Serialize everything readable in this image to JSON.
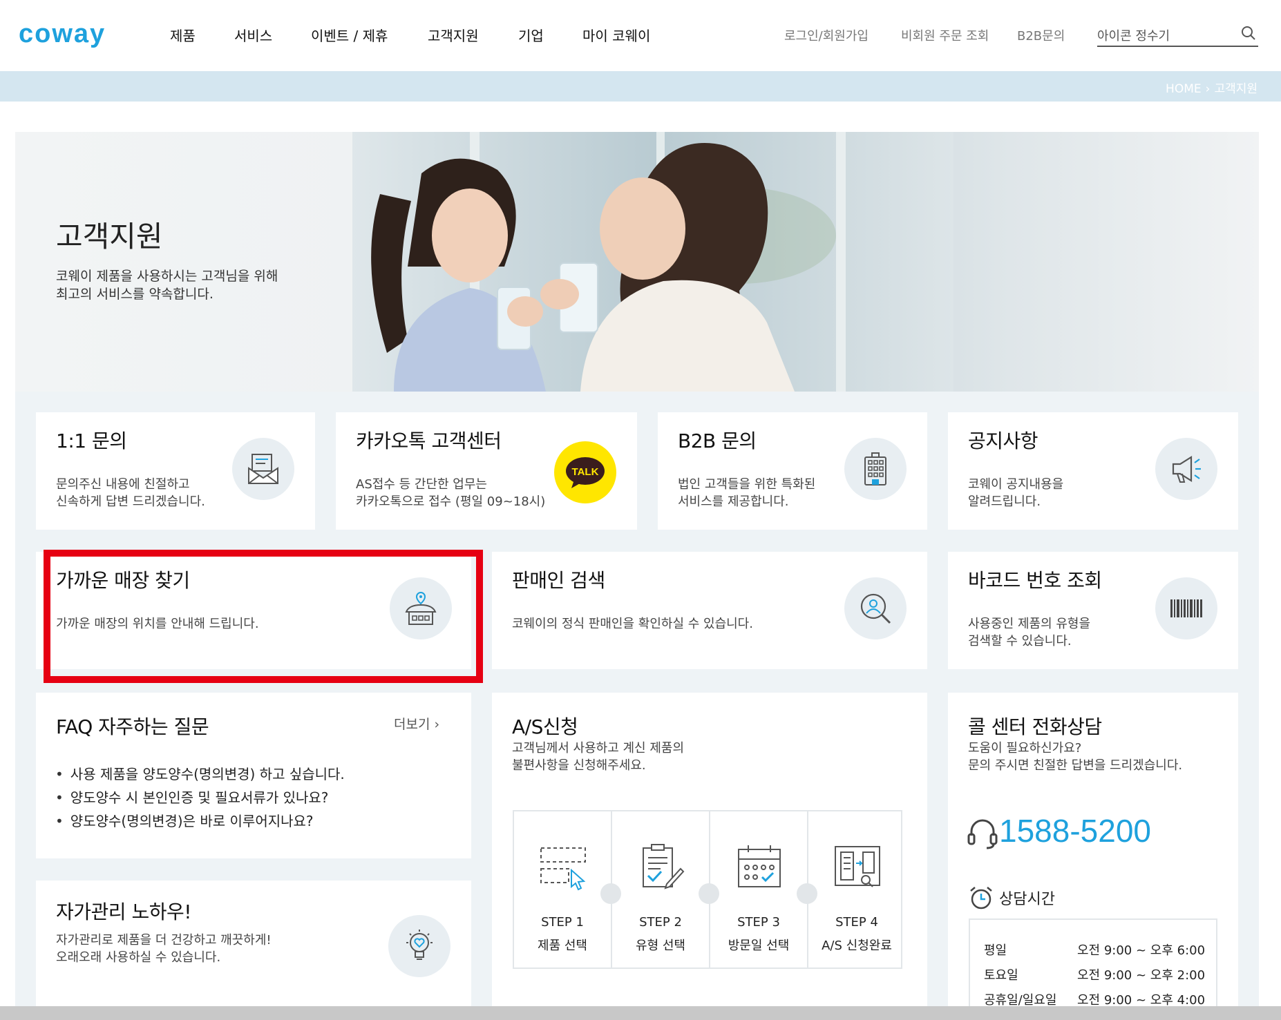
{
  "header": {
    "logo": "coway",
    "menu": [
      "제품",
      "서비스",
      "이벤트 / 제휴",
      "고객지원",
      "기업",
      "마이 코웨이"
    ],
    "util": [
      "로그인/회원가입",
      "비회원 주문 조회",
      "B2B문의"
    ],
    "search_value": "아이콘 정수기"
  },
  "breadcrumb": {
    "home": "HOME",
    "separator": "›",
    "current": "고객지원"
  },
  "hero": {
    "title": "고객지원",
    "desc": "코웨이 제품을 사용하시는 고객님을 위해\n최고의 서비스를 약속합니다."
  },
  "cards": {
    "inquiry": {
      "title": "1:1 문의",
      "desc": "문의주신 내용에 친절하고\n신속하게 답변 드리겠습니다."
    },
    "kakao": {
      "title": "카카오톡 고객센터",
      "desc": "AS접수 등 간단한 업무는\n카카오톡으로 접수 (평일 09~18시)",
      "badge": "TALK"
    },
    "b2b": {
      "title": "B2B 문의",
      "desc": "법인 고객들을 위한 특화된\n서비스를 제공합니다."
    },
    "notice": {
      "title": "공지사항",
      "desc": "코웨이 공지내용을\n알려드립니다."
    },
    "store": {
      "title": "가까운 매장 찾기",
      "desc": "가까운 매장의 위치를 안내해 드립니다."
    },
    "seller": {
      "title": "판매인 검색",
      "desc": "코웨이의 정식 판매인을 확인하실 수 있습니다."
    },
    "barcode": {
      "title": "바코드 번호 조회",
      "desc": "사용중인 제품의 유형을\n검색할 수 있습니다."
    },
    "faq": {
      "title": "FAQ 자주하는 질문",
      "more": "더보기 ›",
      "items": [
        "사용 제품을 양도양수(명의변경) 하고 싶습니다.",
        "양도양수 시 본인인증 및 필요서류가 있나요?",
        "양도양수(명의변경)은 바로 이루어지나요?"
      ]
    },
    "self_care": {
      "title": "자가관리 노하우!",
      "desc": "자가관리로 제품을 더 건강하고 깨끗하게!\n오래오래 사용하실 수 있습니다."
    },
    "as": {
      "title": "A/S신청",
      "desc": "고객님께서 사용하고 계신 제품의\n불편사항을 신청해주세요.",
      "steps": [
        {
          "step": "STEP 1",
          "label": "제품 선택"
        },
        {
          "step": "STEP 2",
          "label": "유형 선택"
        },
        {
          "step": "STEP 3",
          "label": "방문일 선택"
        },
        {
          "step": "STEP 4",
          "label": "A/S 신청완료"
        }
      ]
    },
    "call": {
      "title": "콜 센터 전화상담",
      "desc": "도움이 필요하신가요?\n문의 주시면 친절한 답변을 드리겠습니다.",
      "phone": "1588-5200",
      "hours_title": "상담시간",
      "hours": [
        {
          "day": "평일",
          "time": "오전 9:00 ~ 오후 6:00"
        },
        {
          "day": "토요일",
          "time": "오전 9:00 ~ 오후 2:00"
        },
        {
          "day": "공휴일/일요일",
          "time": "오전 9:00 ~ 오후 4:00"
        }
      ]
    }
  },
  "colors": {
    "brand": "#1ea1dd",
    "highlight": "#e60012",
    "kakao": "#ffe600"
  }
}
